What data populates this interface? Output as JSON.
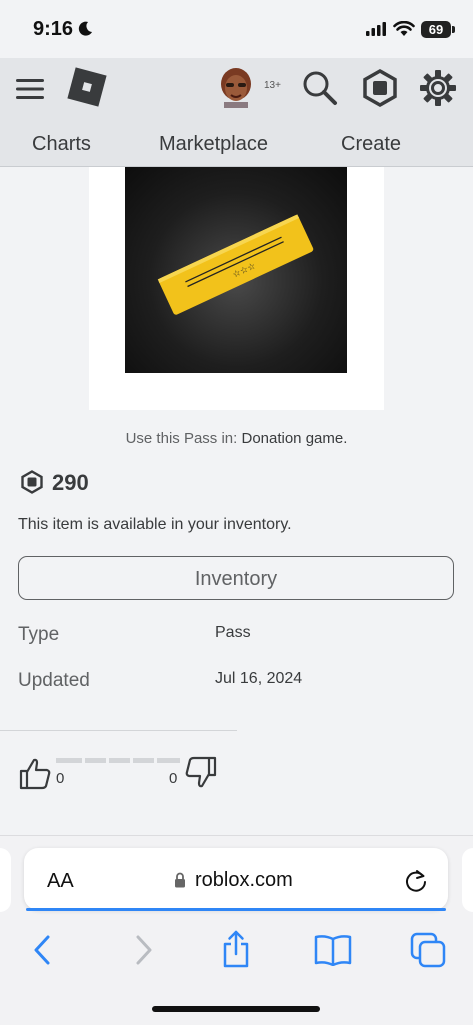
{
  "status_bar": {
    "time": "9:16",
    "battery": "69"
  },
  "header": {
    "age_badge": "13+"
  },
  "nav": {
    "items": [
      {
        "label": "Charts"
      },
      {
        "label": "Marketplace"
      },
      {
        "label": "Create"
      }
    ]
  },
  "item": {
    "use_pass_prefix": "Use this Pass in: ",
    "use_pass_game": "Donation game.",
    "price": "290",
    "availability": "This item is available in your inventory.",
    "inventory_button": "Inventory",
    "details": [
      {
        "label": "Type",
        "value": "Pass"
      },
      {
        "label": "Updated",
        "value": "Jul 16, 2024"
      }
    ],
    "votes": {
      "up": "0",
      "down": "0"
    }
  },
  "browser": {
    "aa": "AA",
    "url": "roblox.com"
  },
  "colors": {
    "header_bg": "#e3e5e8",
    "page_bg": "#f2f3f5",
    "ticket_gold": "#f2c21b",
    "safari_blue": "#2f86f6"
  }
}
